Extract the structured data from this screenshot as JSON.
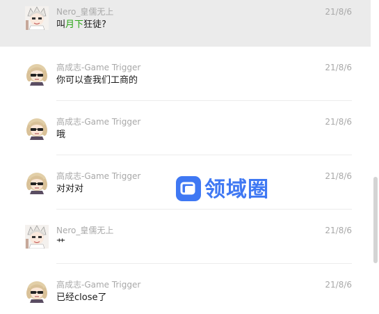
{
  "messages": [
    {
      "sender": "Nero_皇儒无上",
      "date": "21/8/6",
      "text_pre": "叫",
      "text_hl": "月下",
      "text_post": "狂徒?",
      "avatar": "white-hair-anime-avatar"
    },
    {
      "sender": "高成志-Game Trigger",
      "date": "21/8/6",
      "text": "你可以查我们工商的",
      "avatar": "sunglasses-anime-avatar"
    },
    {
      "sender": "高成志-Game Trigger",
      "date": "21/8/6",
      "text": "哦",
      "avatar": "sunglasses-anime-avatar"
    },
    {
      "sender": "高成志-Game Trigger",
      "date": "21/8/6",
      "text": "对对对",
      "avatar": "sunglasses-anime-avatar"
    },
    {
      "sender": "Nero_皇儒无上",
      "date": "21/8/6",
      "text": "艹",
      "avatar": "white-hair-anime-avatar"
    },
    {
      "sender": "高成志-Game Trigger",
      "date": "21/8/6",
      "text": "已经close了",
      "avatar": "sunglasses-anime-avatar"
    }
  ],
  "watermark": {
    "text": "领域圈",
    "icon": "square-chat-logo-icon",
    "color": "#2f6df2"
  },
  "colors": {
    "highlight": "#2aa515",
    "selected_bg": "#ebebeb",
    "meta": "#a8a8a8"
  }
}
